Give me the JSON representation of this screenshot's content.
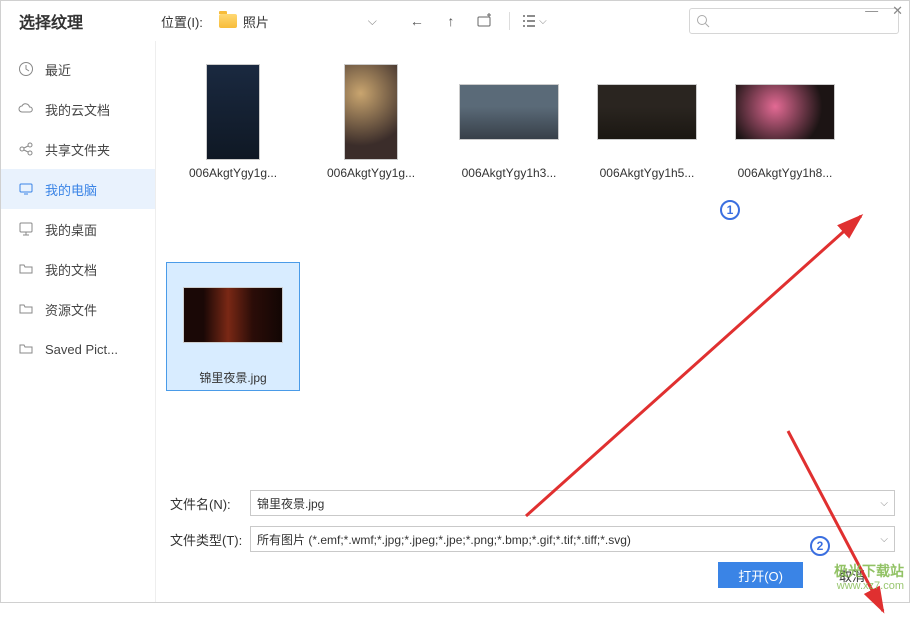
{
  "title": "选择纹理",
  "location": {
    "label": "位置(I):",
    "folder": "照片"
  },
  "window_controls": {
    "min": "—",
    "close": "✕"
  },
  "sidebar": {
    "items": [
      {
        "icon": "clock",
        "label": "最近"
      },
      {
        "icon": "cloud",
        "label": "我的云文档"
      },
      {
        "icon": "share",
        "label": "共享文件夹"
      },
      {
        "icon": "monitor",
        "label": "我的电脑"
      },
      {
        "icon": "desktop",
        "label": "我的桌面"
      },
      {
        "icon": "doc",
        "label": "我的文档"
      },
      {
        "icon": "res",
        "label": "资源文件"
      },
      {
        "icon": "pic",
        "label": "Saved Pict..."
      }
    ],
    "active_index": 3
  },
  "files": [
    {
      "name": "006AkgtYgy1g..."
    },
    {
      "name": "006AkgtYgy1g..."
    },
    {
      "name": "006AkgtYgy1h3..."
    },
    {
      "name": "006AkgtYgy1h5..."
    },
    {
      "name": "006AkgtYgy1h8..."
    },
    {
      "name": "锦里夜景.jpg"
    }
  ],
  "selected_index": 5,
  "filename": {
    "label": "文件名(N):",
    "value": "锦里夜景.jpg"
  },
  "filetype": {
    "label": "文件类型(T):",
    "value": "所有图片 (*.emf;*.wmf;*.jpg;*.jpeg;*.jpe;*.png;*.bmp;*.gif;*.tif;*.tiff;*.svg)"
  },
  "buttons": {
    "open": "打开(O)",
    "cancel": "取消"
  },
  "annotations": {
    "one": "1",
    "two": "2"
  },
  "watermark": {
    "line1": "极光下载站",
    "line2": "www.xz7.com"
  }
}
